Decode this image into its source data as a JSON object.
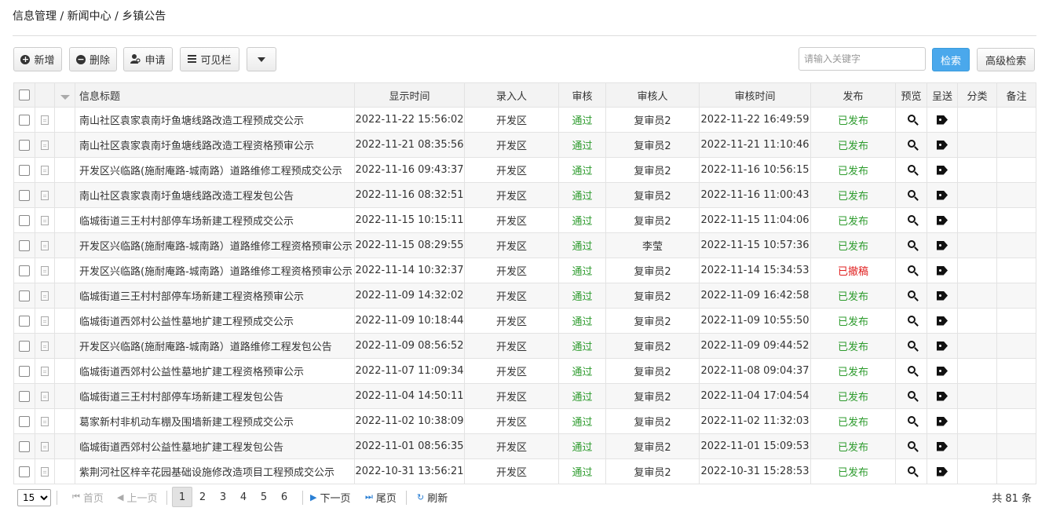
{
  "breadcrumb": "信息管理 / 新闻中心 / 乡镇公告",
  "toolbar": {
    "add_label": "新增",
    "delete_label": "删除",
    "apply_label": "申请",
    "columns_label": "可见栏"
  },
  "search": {
    "placeholder": "请输入关键字",
    "search_label": "检索",
    "advanced_label": "高级检索"
  },
  "table": {
    "headers": {
      "title": "信息标题",
      "display_time": "显示时间",
      "entered_by": "录入人",
      "review": "审核",
      "reviewer": "审核人",
      "review_time": "审核时间",
      "publish": "发布",
      "preview": "预览",
      "submit": "呈送",
      "category": "分类",
      "remark": "备注"
    },
    "rows": [
      {
        "title": "南山社区袁家袁南圩鱼塘线路改造工程预成交公示",
        "display_time": "2022-11-22 15:56:02",
        "entered_by": "开发区",
        "review": "通过",
        "reviewer": "复审员2",
        "review_time": "2022-11-22 16:49:59",
        "publish": "已发布",
        "status": "published"
      },
      {
        "title": "南山社区袁家袁南圩鱼塘线路改造工程资格预审公示",
        "display_time": "2022-11-21 08:35:56",
        "entered_by": "开发区",
        "review": "通过",
        "reviewer": "复审员2",
        "review_time": "2022-11-21 11:10:46",
        "publish": "已发布",
        "status": "published"
      },
      {
        "title": "开发区兴临路(施耐庵路-城南路）道路维修工程预成交公示",
        "display_time": "2022-11-16 09:43:37",
        "entered_by": "开发区",
        "review": "通过",
        "reviewer": "复审员2",
        "review_time": "2022-11-16 10:56:15",
        "publish": "已发布",
        "status": "published"
      },
      {
        "title": "南山社区袁家袁南圩鱼塘线路改造工程发包公告",
        "display_time": "2022-11-16 08:32:51",
        "entered_by": "开发区",
        "review": "通过",
        "reviewer": "复审员2",
        "review_time": "2022-11-16 11:00:43",
        "publish": "已发布",
        "status": "published"
      },
      {
        "title": "临城街道三王村村部停车场新建工程预成交公示",
        "display_time": "2022-11-15 10:15:11",
        "entered_by": "开发区",
        "review": "通过",
        "reviewer": "复审员2",
        "review_time": "2022-11-15 11:04:06",
        "publish": "已发布",
        "status": "published"
      },
      {
        "title": "开发区兴临路(施耐庵路-城南路）道路维修工程资格预审公示",
        "display_time": "2022-11-15 08:29:55",
        "entered_by": "开发区",
        "review": "通过",
        "reviewer": "李莹",
        "review_time": "2022-11-15 10:57:36",
        "publish": "已发布",
        "status": "published"
      },
      {
        "title": "开发区兴临路(施耐庵路-城南路）道路维修工程资格预审公示",
        "display_time": "2022-11-14 10:32:37",
        "entered_by": "开发区",
        "review": "通过",
        "reviewer": "复审员2",
        "review_time": "2022-11-14 15:34:53",
        "publish": "已撤稿",
        "status": "withdrawn"
      },
      {
        "title": "临城街道三王村村部停车场新建工程资格预审公示",
        "display_time": "2022-11-09 14:32:02",
        "entered_by": "开发区",
        "review": "通过",
        "reviewer": "复审员2",
        "review_time": "2022-11-09 16:42:58",
        "publish": "已发布",
        "status": "published"
      },
      {
        "title": "临城街道西郊村公益性墓地扩建工程预成交公示",
        "display_time": "2022-11-09 10:18:44",
        "entered_by": "开发区",
        "review": "通过",
        "reviewer": "复审员2",
        "review_time": "2022-11-09 10:55:50",
        "publish": "已发布",
        "status": "published"
      },
      {
        "title": "开发区兴临路(施耐庵路-城南路）道路维修工程发包公告",
        "display_time": "2022-11-09 08:56:52",
        "entered_by": "开发区",
        "review": "通过",
        "reviewer": "复审员2",
        "review_time": "2022-11-09 09:44:52",
        "publish": "已发布",
        "status": "published"
      },
      {
        "title": "临城街道西郊村公益性墓地扩建工程资格预审公示",
        "display_time": "2022-11-07 11:09:34",
        "entered_by": "开发区",
        "review": "通过",
        "reviewer": "复审员2",
        "review_time": "2022-11-08 09:04:37",
        "publish": "已发布",
        "status": "published"
      },
      {
        "title": "临城街道三王村村部停车场新建工程发包公告",
        "display_time": "2022-11-04 14:50:11",
        "entered_by": "开发区",
        "review": "通过",
        "reviewer": "复审员2",
        "review_time": "2022-11-04 17:04:54",
        "publish": "已发布",
        "status": "published"
      },
      {
        "title": "葛家新村非机动车棚及围墙新建工程预成交公示",
        "display_time": "2022-11-02 10:38:09",
        "entered_by": "开发区",
        "review": "通过",
        "reviewer": "复审员2",
        "review_time": "2022-11-02 11:32:03",
        "publish": "已发布",
        "status": "published"
      },
      {
        "title": "临城街道西郊村公益性墓地扩建工程发包公告",
        "display_time": "2022-11-01 08:56:35",
        "entered_by": "开发区",
        "review": "通过",
        "reviewer": "复审员2",
        "review_time": "2022-11-01 15:09:53",
        "publish": "已发布",
        "status": "published"
      },
      {
        "title": "紫荆河社区梓辛花园基础设施修改造项目工程预成交公示",
        "display_time": "2022-10-31 13:56:21",
        "entered_by": "开发区",
        "review": "通过",
        "reviewer": "复审员2",
        "review_time": "2022-10-31 15:28:53",
        "publish": "已发布",
        "status": "published"
      }
    ]
  },
  "pager": {
    "page_size": "15",
    "page_size_options": [
      "15"
    ],
    "first_label": "首页",
    "prev_label": "上一页",
    "pages": [
      "1",
      "2",
      "3",
      "4",
      "5",
      "6"
    ],
    "current_page": "1",
    "next_label": "下一页",
    "last_label": "尾页",
    "refresh_label": "刷新",
    "total": "共 81 条"
  },
  "colors": {
    "primary": "#4aa8ec",
    "published": "#2d9b2d",
    "withdrawn": "#e02020"
  },
  "icons": {
    "add": "plus-circle-icon",
    "delete": "minus-circle-icon",
    "apply": "user-search-icon",
    "columns": "list-icon",
    "preview": "magnifier-icon",
    "submit": "tag-icon",
    "refresh": "refresh-icon"
  }
}
